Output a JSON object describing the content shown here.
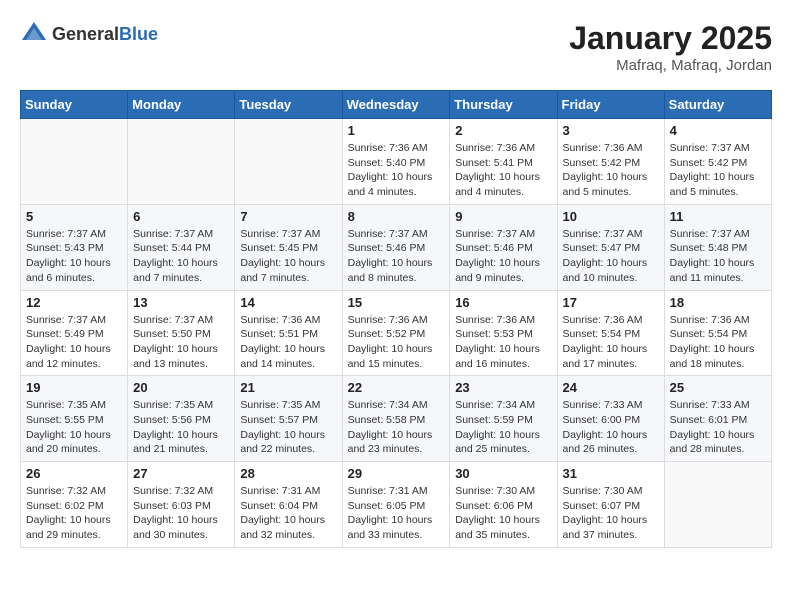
{
  "logo": {
    "text_general": "General",
    "text_blue": "Blue"
  },
  "title": {
    "month": "January 2025",
    "location": "Mafraq, Mafraq, Jordan"
  },
  "weekdays": [
    "Sunday",
    "Monday",
    "Tuesday",
    "Wednesday",
    "Thursday",
    "Friday",
    "Saturday"
  ],
  "weeks": [
    [
      {
        "num": "",
        "info": ""
      },
      {
        "num": "",
        "info": ""
      },
      {
        "num": "",
        "info": ""
      },
      {
        "num": "1",
        "info": "Sunrise: 7:36 AM\nSunset: 5:40 PM\nDaylight: 10 hours\nand 4 minutes."
      },
      {
        "num": "2",
        "info": "Sunrise: 7:36 AM\nSunset: 5:41 PM\nDaylight: 10 hours\nand 4 minutes."
      },
      {
        "num": "3",
        "info": "Sunrise: 7:36 AM\nSunset: 5:42 PM\nDaylight: 10 hours\nand 5 minutes."
      },
      {
        "num": "4",
        "info": "Sunrise: 7:37 AM\nSunset: 5:42 PM\nDaylight: 10 hours\nand 5 minutes."
      }
    ],
    [
      {
        "num": "5",
        "info": "Sunrise: 7:37 AM\nSunset: 5:43 PM\nDaylight: 10 hours\nand 6 minutes."
      },
      {
        "num": "6",
        "info": "Sunrise: 7:37 AM\nSunset: 5:44 PM\nDaylight: 10 hours\nand 7 minutes."
      },
      {
        "num": "7",
        "info": "Sunrise: 7:37 AM\nSunset: 5:45 PM\nDaylight: 10 hours\nand 7 minutes."
      },
      {
        "num": "8",
        "info": "Sunrise: 7:37 AM\nSunset: 5:46 PM\nDaylight: 10 hours\nand 8 minutes."
      },
      {
        "num": "9",
        "info": "Sunrise: 7:37 AM\nSunset: 5:46 PM\nDaylight: 10 hours\nand 9 minutes."
      },
      {
        "num": "10",
        "info": "Sunrise: 7:37 AM\nSunset: 5:47 PM\nDaylight: 10 hours\nand 10 minutes."
      },
      {
        "num": "11",
        "info": "Sunrise: 7:37 AM\nSunset: 5:48 PM\nDaylight: 10 hours\nand 11 minutes."
      }
    ],
    [
      {
        "num": "12",
        "info": "Sunrise: 7:37 AM\nSunset: 5:49 PM\nDaylight: 10 hours\nand 12 minutes."
      },
      {
        "num": "13",
        "info": "Sunrise: 7:37 AM\nSunset: 5:50 PM\nDaylight: 10 hours\nand 13 minutes."
      },
      {
        "num": "14",
        "info": "Sunrise: 7:36 AM\nSunset: 5:51 PM\nDaylight: 10 hours\nand 14 minutes."
      },
      {
        "num": "15",
        "info": "Sunrise: 7:36 AM\nSunset: 5:52 PM\nDaylight: 10 hours\nand 15 minutes."
      },
      {
        "num": "16",
        "info": "Sunrise: 7:36 AM\nSunset: 5:53 PM\nDaylight: 10 hours\nand 16 minutes."
      },
      {
        "num": "17",
        "info": "Sunrise: 7:36 AM\nSunset: 5:54 PM\nDaylight: 10 hours\nand 17 minutes."
      },
      {
        "num": "18",
        "info": "Sunrise: 7:36 AM\nSunset: 5:54 PM\nDaylight: 10 hours\nand 18 minutes."
      }
    ],
    [
      {
        "num": "19",
        "info": "Sunrise: 7:35 AM\nSunset: 5:55 PM\nDaylight: 10 hours\nand 20 minutes."
      },
      {
        "num": "20",
        "info": "Sunrise: 7:35 AM\nSunset: 5:56 PM\nDaylight: 10 hours\nand 21 minutes."
      },
      {
        "num": "21",
        "info": "Sunrise: 7:35 AM\nSunset: 5:57 PM\nDaylight: 10 hours\nand 22 minutes."
      },
      {
        "num": "22",
        "info": "Sunrise: 7:34 AM\nSunset: 5:58 PM\nDaylight: 10 hours\nand 23 minutes."
      },
      {
        "num": "23",
        "info": "Sunrise: 7:34 AM\nSunset: 5:59 PM\nDaylight: 10 hours\nand 25 minutes."
      },
      {
        "num": "24",
        "info": "Sunrise: 7:33 AM\nSunset: 6:00 PM\nDaylight: 10 hours\nand 26 minutes."
      },
      {
        "num": "25",
        "info": "Sunrise: 7:33 AM\nSunset: 6:01 PM\nDaylight: 10 hours\nand 28 minutes."
      }
    ],
    [
      {
        "num": "26",
        "info": "Sunrise: 7:32 AM\nSunset: 6:02 PM\nDaylight: 10 hours\nand 29 minutes."
      },
      {
        "num": "27",
        "info": "Sunrise: 7:32 AM\nSunset: 6:03 PM\nDaylight: 10 hours\nand 30 minutes."
      },
      {
        "num": "28",
        "info": "Sunrise: 7:31 AM\nSunset: 6:04 PM\nDaylight: 10 hours\nand 32 minutes."
      },
      {
        "num": "29",
        "info": "Sunrise: 7:31 AM\nSunset: 6:05 PM\nDaylight: 10 hours\nand 33 minutes."
      },
      {
        "num": "30",
        "info": "Sunrise: 7:30 AM\nSunset: 6:06 PM\nDaylight: 10 hours\nand 35 minutes."
      },
      {
        "num": "31",
        "info": "Sunrise: 7:30 AM\nSunset: 6:07 PM\nDaylight: 10 hours\nand 37 minutes."
      },
      {
        "num": "",
        "info": ""
      }
    ]
  ]
}
